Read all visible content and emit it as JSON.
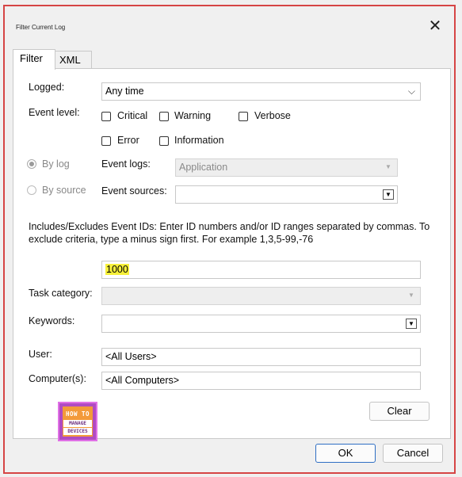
{
  "window": {
    "title": "Filter Current Log"
  },
  "tabs": [
    {
      "label": "Filter"
    },
    {
      "label": "XML"
    }
  ],
  "logged": {
    "label": "Logged:",
    "value": "Any time"
  },
  "event_level": {
    "label": "Event level:",
    "options": [
      {
        "label": "Critical",
        "checked": false
      },
      {
        "label": "Warning",
        "checked": false
      },
      {
        "label": "Verbose",
        "checked": false
      },
      {
        "label": "Error",
        "checked": false
      },
      {
        "label": "Information",
        "checked": false
      }
    ]
  },
  "by_log": {
    "label": "By log",
    "checked": true
  },
  "by_source": {
    "label": "By source",
    "checked": false
  },
  "event_logs": {
    "label": "Event logs:",
    "value": "Application"
  },
  "event_sources": {
    "label": "Event sources:",
    "value": ""
  },
  "event_ids": {
    "description": "Includes/Excludes Event IDs: Enter ID numbers and/or ID ranges separated by commas. To exclude criteria, type a minus sign first. For example 1,3,5-99,-76",
    "value": "1000"
  },
  "task_category": {
    "label": "Task category:",
    "value": ""
  },
  "keywords": {
    "label": "Keywords:",
    "value": ""
  },
  "user": {
    "label": "User:",
    "value": "<All Users>"
  },
  "computer": {
    "label": "Computer(s):",
    "value": "<All Computers>"
  },
  "buttons": {
    "clear": "Clear",
    "ok": "OK",
    "cancel": "Cancel"
  },
  "logo": {
    "line1": "HOW TO",
    "line2": "MANAGE",
    "line3": "DEVICES"
  },
  "colors": {
    "frame_border": "#d64545",
    "highlight": "#f7f03a",
    "ok_border": "#2f6fc4",
    "logo_bg": "#b04bc2"
  }
}
